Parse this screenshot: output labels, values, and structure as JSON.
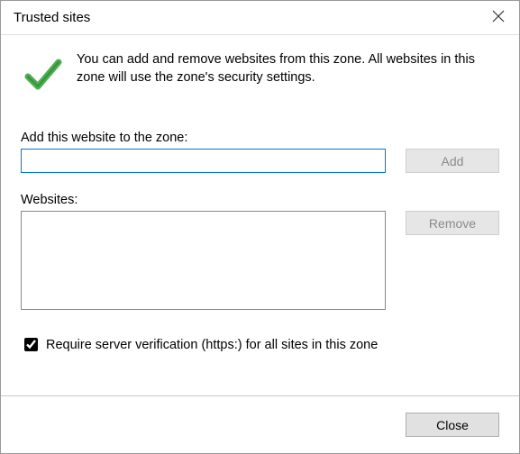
{
  "window": {
    "title": "Trusted sites",
    "intro": "You can add and remove websites from this zone. All websites in this zone will use the zone's security settings."
  },
  "labels": {
    "addPrompt": "Add this website to the zone:",
    "websites": "Websites:",
    "requireHttps": "Require server verification (https:) for all sites in this zone"
  },
  "inputs": {
    "url": ""
  },
  "buttons": {
    "add": "Add",
    "remove": "Remove",
    "close": "Close"
  },
  "state": {
    "requireHttpsChecked": true,
    "addDisabled": true,
    "removeDisabled": true
  },
  "icons": {
    "check": "checkmark-icon",
    "close": "close-icon"
  }
}
